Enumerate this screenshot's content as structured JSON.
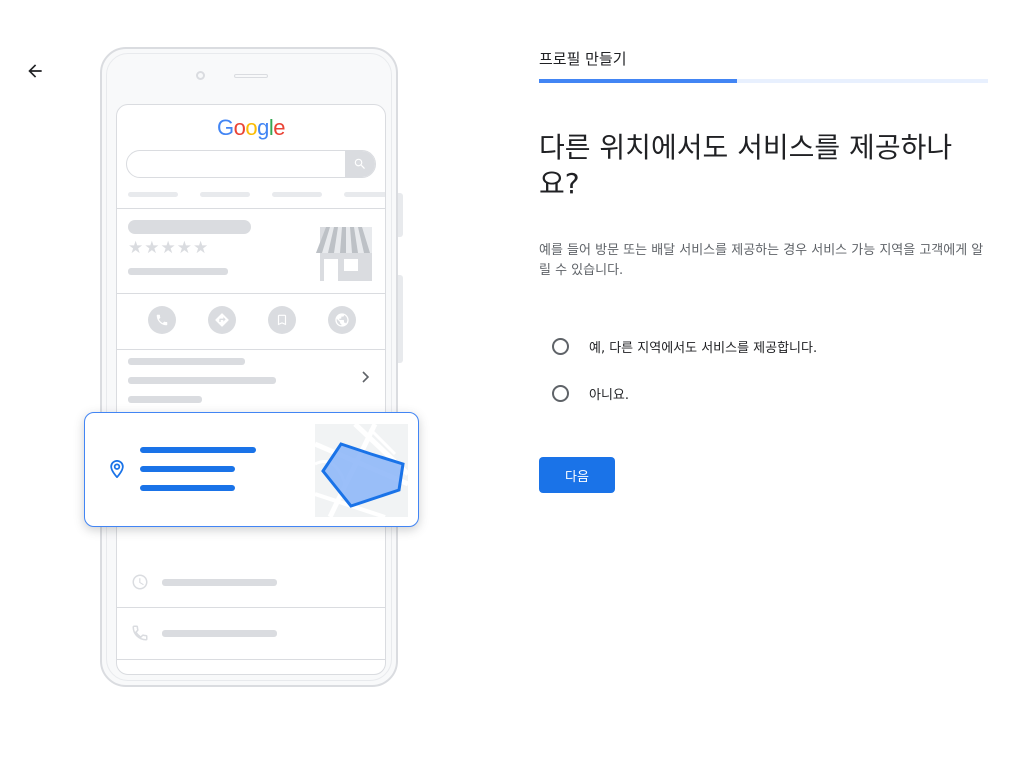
{
  "illustration": {
    "search_engine_logo": "Google"
  },
  "header": {
    "step_label": "프로필 만들기",
    "progress": 0.44
  },
  "main": {
    "heading": "다른 위치에서도 서비스를 제공하나요?",
    "description": "예를 들어 방문 또는 배달 서비스를 제공하는 경우 서비스 가능 지역을 고객에게 알릴 수 있습니다.",
    "options": [
      {
        "label": "예, 다른 지역에서도 서비스를 제공합니다.",
        "selected": false
      },
      {
        "label": "아니요.",
        "selected": false
      }
    ],
    "next_label": "다음"
  },
  "colors": {
    "accent": "#1a73e8",
    "progress_track": "#e8f0fe",
    "illustration_gray": "#dadce0"
  }
}
